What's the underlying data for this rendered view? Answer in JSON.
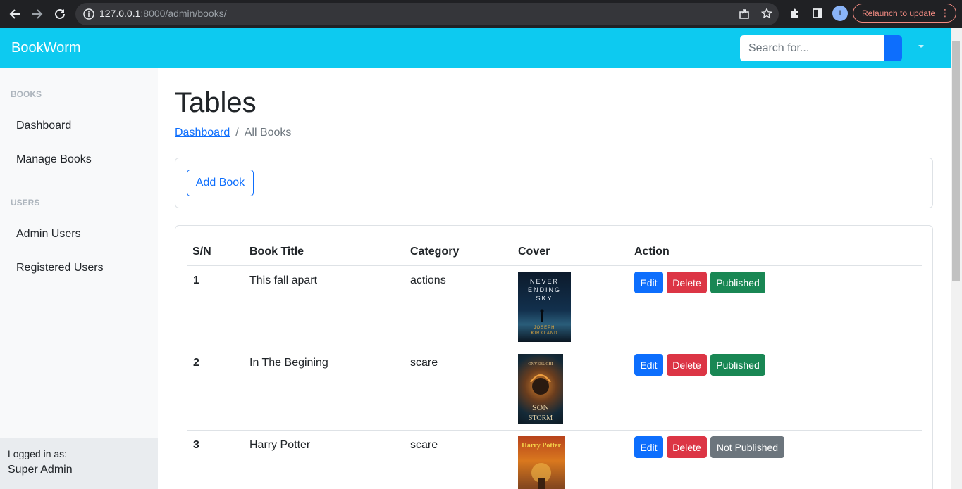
{
  "browser": {
    "url_host": "127.0.0.1",
    "url_path": ":8000/admin/books/",
    "profile_initial": "I",
    "relaunch_label": "Relaunch to update"
  },
  "topbar": {
    "brand": "BookWorm",
    "search_placeholder": "Search for..."
  },
  "sidebar": {
    "sections": [
      {
        "heading": "BOOKS",
        "links": [
          "Dashboard",
          "Manage Books"
        ]
      },
      {
        "heading": "USERS",
        "links": [
          "Admin Users",
          "Registered Users"
        ]
      }
    ],
    "footer_label": "Logged in as:",
    "footer_user": "Super Admin"
  },
  "main": {
    "title": "Tables",
    "breadcrumb": {
      "link": "Dashboard",
      "separator": "/",
      "active": "All Books"
    },
    "add_button": "Add Book",
    "table": {
      "headers": [
        "S/N",
        "Book Title",
        "Category",
        "Cover",
        "Action"
      ],
      "rows": [
        {
          "sn": "1",
          "title": "This fall apart",
          "category": "actions",
          "cover_lines": [
            "NEVER",
            "ENDING",
            "SKY",
            "JOSEPH",
            "KIRKLAND"
          ],
          "edit": "Edit",
          "delete": "Delete",
          "status": "Published",
          "published": true
        },
        {
          "sn": "2",
          "title": "In The Begining",
          "category": "scare",
          "cover_lines": [
            "ONYEBUCHI",
            "SON",
            "STORM"
          ],
          "edit": "Edit",
          "delete": "Delete",
          "status": "Published",
          "published": true
        },
        {
          "sn": "3",
          "title": "Harry Potter",
          "category": "scare",
          "cover_lines": [
            "Harry Potter"
          ],
          "edit": "Edit",
          "delete": "Delete",
          "status": "Not Published",
          "published": false
        }
      ]
    }
  },
  "colors": {
    "topbar": "#0dcaf0",
    "primary": "#0d6efd",
    "danger": "#dc3545",
    "success": "#198754",
    "secondary": "#6c757d"
  }
}
